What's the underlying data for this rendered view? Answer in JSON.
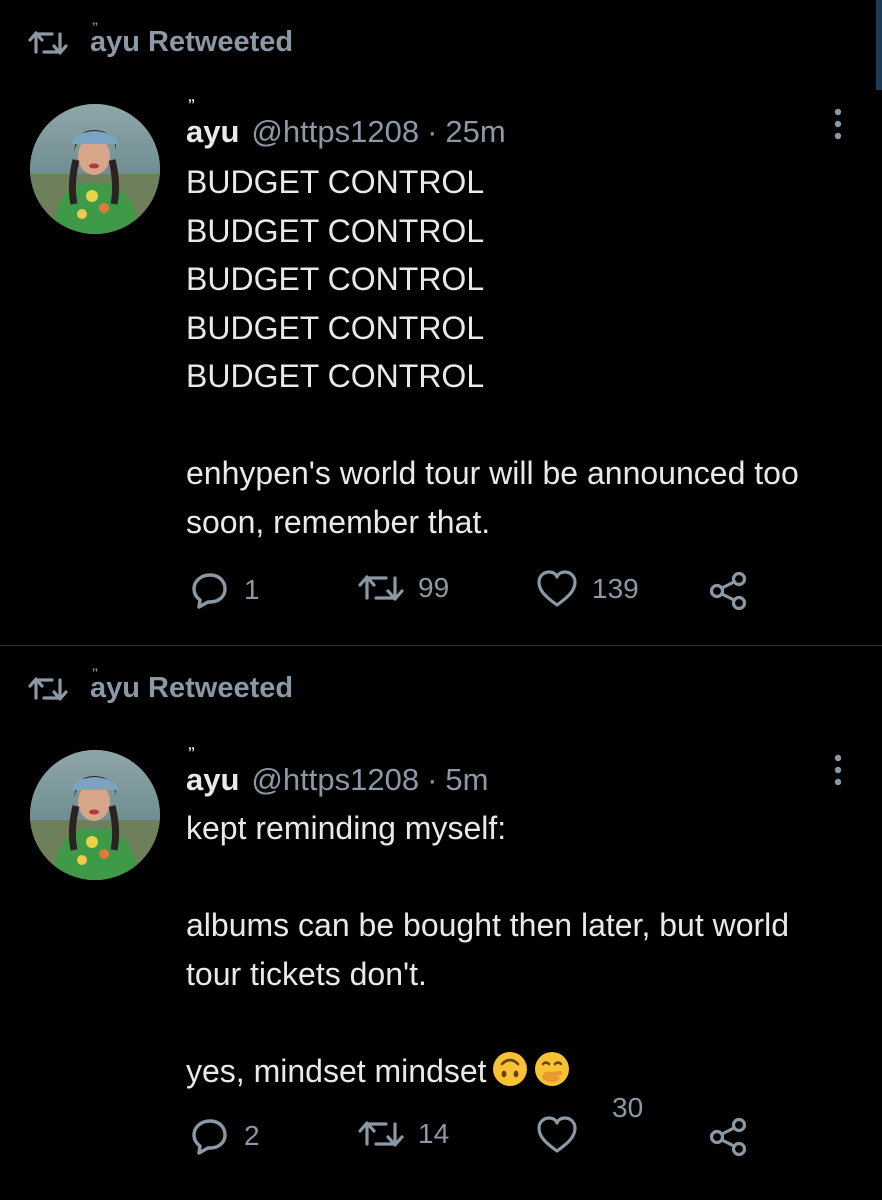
{
  "colors": {
    "background": "#000000",
    "text_primary": "#e7e9ea",
    "text_secondary": "#8b98a5",
    "divider": "#2f3336"
  },
  "tweets": [
    {
      "retweeted_by_mark": "ˮ",
      "retweeted_by": "ayu Retweeted",
      "name_mark": "ˮ",
      "display_name": "ayu",
      "handle": "@https1208",
      "separator": "·",
      "time": "25m",
      "text": "BUDGET CONTROL\nBUDGET CONTROL\nBUDGET CONTROL\nBUDGET CONTROL\nBUDGET CONTROL\n\nenhypen's world tour will be announced too soon, remember that.",
      "replies": "1",
      "retweets": "99",
      "likes": "139",
      "icons": [
        "retweet-icon",
        "avatar",
        "more-icon",
        "reply-icon",
        "retweet-icon",
        "like-icon",
        "share-icon"
      ]
    },
    {
      "retweeted_by_mark": "ˮ",
      "retweeted_by": "ayu Retweeted",
      "name_mark": "ˮ",
      "display_name": "ayu",
      "handle": "@https1208",
      "separator": "·",
      "time": "5m",
      "text": "kept reminding myself:\n\nalbums can be bought then later, but world tour tickets don't.\n\nyes, mindset mindset",
      "emojis": [
        "upside-down-face-emoji",
        "face-with-hand-over-mouth-emoji"
      ],
      "replies": "2",
      "retweets": "14",
      "likes": "30",
      "icons": [
        "retweet-icon",
        "avatar",
        "more-icon",
        "reply-icon",
        "retweet-icon",
        "like-icon",
        "share-icon"
      ]
    }
  ]
}
